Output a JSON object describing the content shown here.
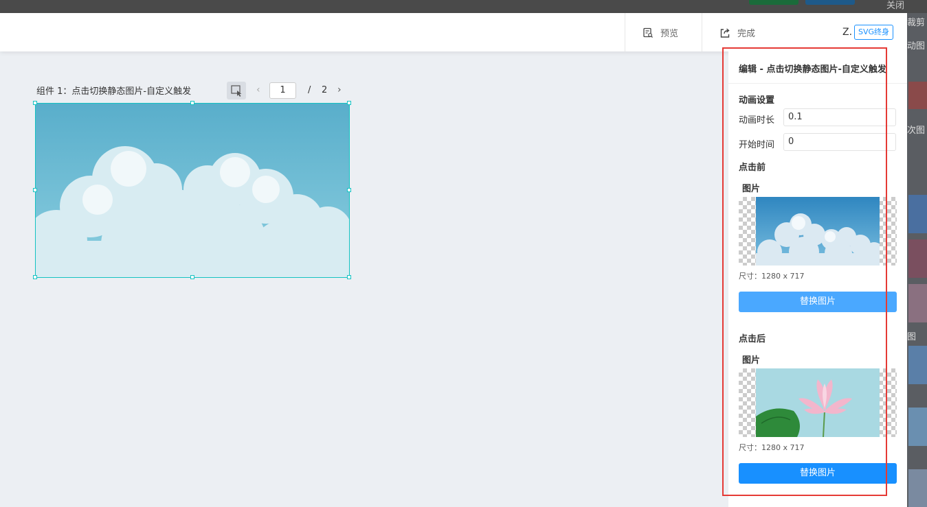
{
  "background_app": {
    "close_label": "关闭",
    "right_texts": [
      "裁剪",
      "动图",
      "次图",
      "图"
    ]
  },
  "header": {
    "preview_label": "预览",
    "done_label": "完成",
    "logo_letter": "Z.",
    "badge_label": "SVG终身"
  },
  "canvas": {
    "component_label": "组件 1：点击切换静态图片-自定义触发",
    "page_current": "1",
    "page_separator": "/",
    "page_total": "2"
  },
  "panel": {
    "title": "编辑 - 点击切换静态图片-自定义触发",
    "animation_section": "动画设置",
    "duration_label": "动画时长",
    "duration_value": "0.1",
    "start_label": "开始时间",
    "start_value": "0",
    "before_section": "点击前",
    "before_image_label": "图片",
    "before_size": "尺寸：1280 x 717",
    "before_replace": "替换图片",
    "after_section": "点击后",
    "after_image_label": "图片",
    "after_size": "尺寸：1280 x 717",
    "after_replace": "替换图片"
  },
  "colors": {
    "accent": "#1890ff",
    "accent_light": "#4aa8ff",
    "selection": "#13c2c2",
    "highlight": "#e53935"
  }
}
